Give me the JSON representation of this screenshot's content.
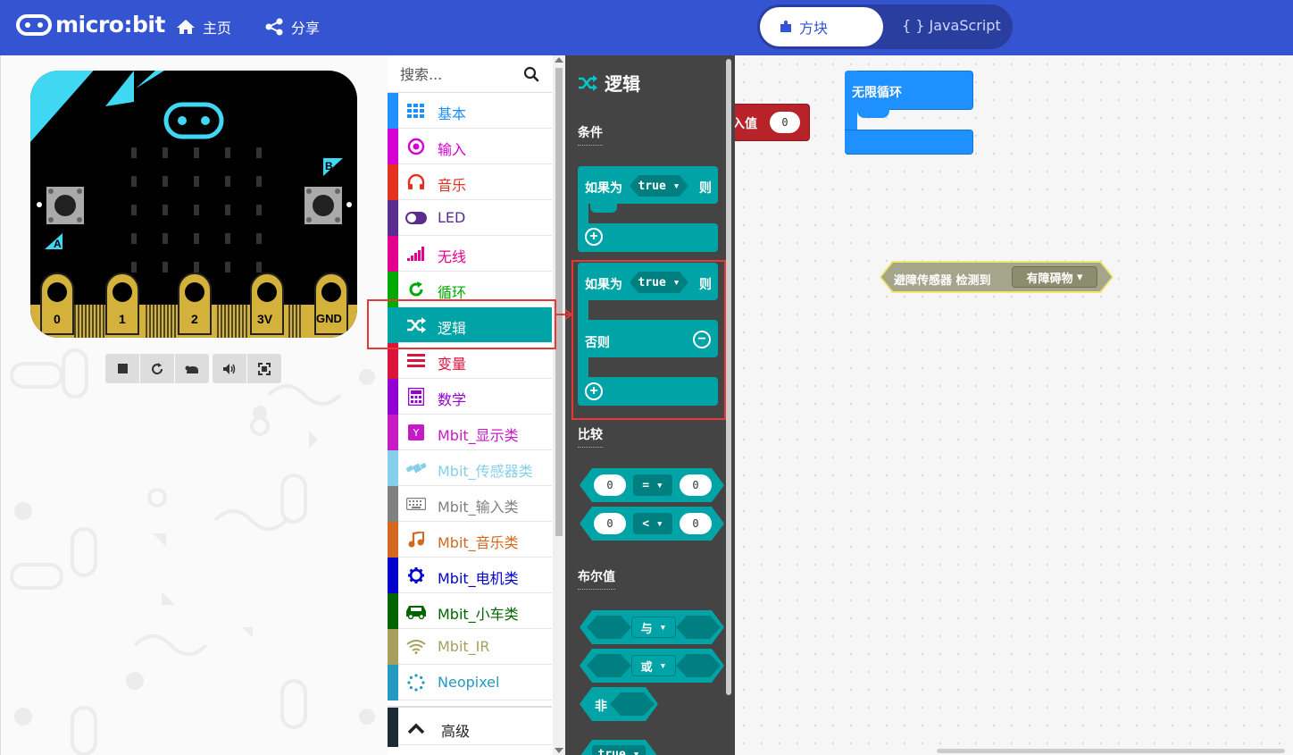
{
  "header": {
    "logo": "micro:bit",
    "home_label": "主页",
    "share_label": "分享",
    "toggle_blocks": "方块",
    "toggle_js": "{ } JavaScript",
    "colors": {
      "bar": "#3454d1"
    }
  },
  "simulator": {
    "pins": [
      "0",
      "1",
      "2",
      "3V",
      "GND"
    ],
    "button_a": "A",
    "button_b": "B",
    "controls": [
      "stop-icon",
      "restart-icon",
      "slow-motion-icon",
      "mute-icon",
      "fullscreen-icon"
    ]
  },
  "toolbox": {
    "search_placeholder": "搜索...",
    "categories": [
      {
        "label": "基本",
        "color": "#1e90ff",
        "icon": "grid-icon"
      },
      {
        "label": "输入",
        "color": "#d400d4",
        "icon": "target-icon"
      },
      {
        "label": "音乐",
        "color": "#e63022",
        "icon": "headphones-icon"
      },
      {
        "label": "LED",
        "color": "#5c2d91",
        "icon": "toggle-icon"
      },
      {
        "label": "无线",
        "color": "#e3008c",
        "icon": "signal-icon"
      },
      {
        "label": "循环",
        "color": "#00aa00",
        "icon": "refresh-icon"
      },
      {
        "label": "逻辑",
        "color": "#00a4a6",
        "icon": "shuffle-icon"
      },
      {
        "label": "变量",
        "color": "#dc143c",
        "icon": "list-icon"
      },
      {
        "label": "数学",
        "color": "#9400d3",
        "icon": "calculator-icon"
      },
      {
        "label": "Mbit_显示类",
        "color": "#c71ac7",
        "icon": "y-box-icon"
      },
      {
        "label": "Mbit_传感器类",
        "color": "#87ceeb",
        "icon": "satellite-icon"
      },
      {
        "label": "Mbit_输入类",
        "color": "#808080",
        "icon": "keyboard-icon"
      },
      {
        "label": "Mbit_音乐类",
        "color": "#d2691e",
        "icon": "music-note-icon"
      },
      {
        "label": "Mbit_电机类",
        "color": "#0000cd",
        "icon": "gear-icon"
      },
      {
        "label": "Mbit_小车类",
        "color": "#006400",
        "icon": "car-icon"
      },
      {
        "label": "Mbit_IR",
        "color": "#a89f5e",
        "icon": "wifi-icon"
      },
      {
        "label": "Neopixel",
        "color": "#2699bf",
        "icon": "circle-dots-icon"
      }
    ],
    "advanced_label": "高级"
  },
  "flyout": {
    "title": "逻辑",
    "sections": {
      "conditions": "条件",
      "comparison": "比较",
      "boolean": "布尔值"
    },
    "if_label": "如果为",
    "true_label": "true",
    "then_label": "则",
    "else_label": "否则",
    "compare_zero": "0",
    "eq_op": "=",
    "lt_op": "<",
    "and_label": "与",
    "or_label": "或",
    "not_label": "非",
    "bottom_partial": "true"
  },
  "workspace": {
    "partial_block_label": "入值",
    "partial_block_value": "0",
    "forever_label": "无限循环",
    "sensor_label": "避障传感器 检测到",
    "sensor_option": "有障碍物"
  }
}
